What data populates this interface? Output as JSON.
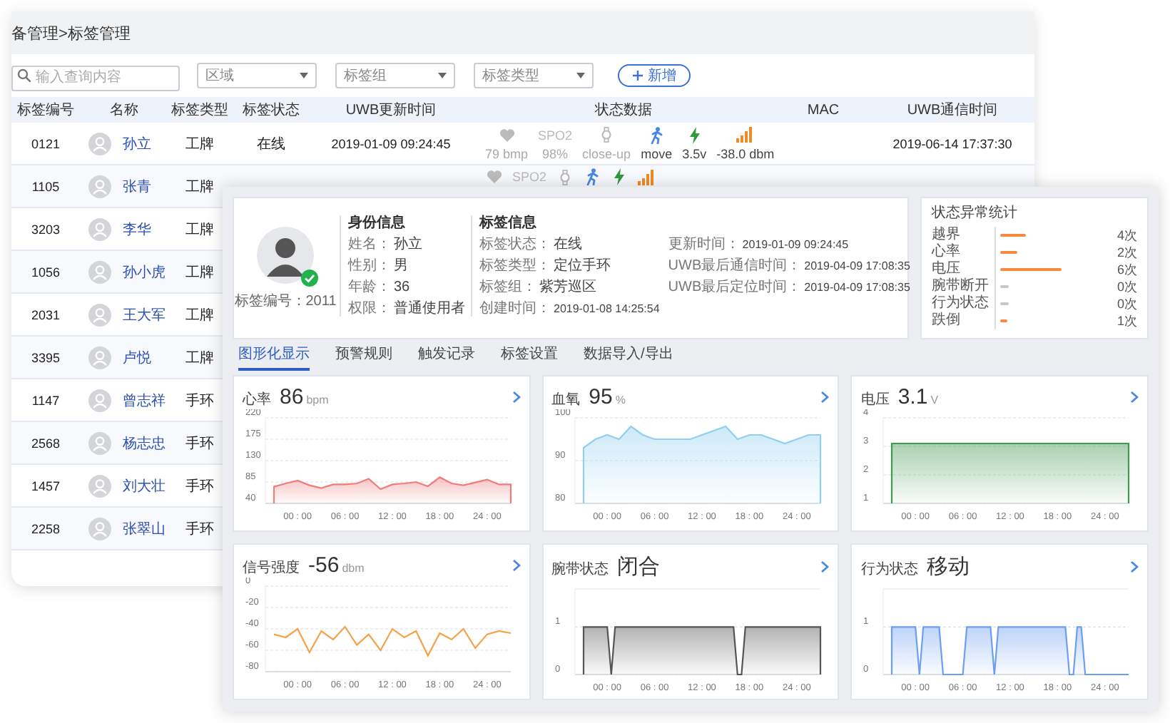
{
  "list_window": {
    "breadcrumb": "备管理>标签管理",
    "search": {
      "placeholder": "输入查询内容"
    },
    "filters": [
      {
        "placeholder": "区域"
      },
      {
        "placeholder": "标签组"
      },
      {
        "placeholder": "标签类型"
      }
    ],
    "add_button": "新增",
    "table": {
      "columns": [
        "标签编号",
        "名称",
        "标签类型",
        "标签状态",
        "UWB更新时间",
        "状态数据",
        "MAC",
        "UWB通信时间"
      ],
      "rows": [
        {
          "id": "0121",
          "name": "孙立",
          "type": "工牌",
          "status": "在线",
          "uwb_update_time": "2019-01-09 09:24:45",
          "status_data": [
            {
              "kind": "heart",
              "active": false,
              "reading": "79 bmp"
            },
            {
              "kind": "spo2",
              "active": false,
              "label": "SPO2",
              "reading": "98%"
            },
            {
              "kind": "wristband",
              "active": false,
              "reading": "close-up"
            },
            {
              "kind": "motion",
              "active": true,
              "reading": "move"
            },
            {
              "kind": "battery",
              "active": true,
              "reading": "3.5v"
            },
            {
              "kind": "signal",
              "active": true,
              "reading": "-38.0 dbm"
            }
          ],
          "uwb_comm_time": "2019-06-14 17:37:30"
        },
        {
          "id": "1105",
          "name": "张青",
          "type": "工牌",
          "status_data": [
            {
              "kind": "heart",
              "active": false
            },
            {
              "kind": "spo2",
              "active": false,
              "label": "SPO2"
            },
            {
              "kind": "wristband",
              "active": false
            },
            {
              "kind": "motion",
              "active": true
            },
            {
              "kind": "battery",
              "active": true
            },
            {
              "kind": "signal",
              "active": true
            }
          ]
        },
        {
          "id": "3203",
          "name": "李华",
          "type": "工牌"
        },
        {
          "id": "1056",
          "name": "孙小虎",
          "type": "工牌"
        },
        {
          "id": "2031",
          "name": "王大军",
          "type": "工牌"
        },
        {
          "id": "3395",
          "name": "卢悦",
          "type": "工牌"
        },
        {
          "id": "1147",
          "name": "曾志祥",
          "type": "手环"
        },
        {
          "id": "2568",
          "name": "杨志忠",
          "type": "手环"
        },
        {
          "id": "1457",
          "name": "刘大壮",
          "type": "手环"
        },
        {
          "id": "2258",
          "name": "张翠山",
          "type": "手环"
        }
      ]
    }
  },
  "detail_panel": {
    "profile": {
      "tag_number": "标签编号：2011",
      "identity": {
        "heading": "身份信息",
        "fields": [
          {
            "label": "姓名：",
            "value": "孙立"
          },
          {
            "label": "性别：",
            "value": "男"
          },
          {
            "label": "年龄：",
            "value": "36"
          },
          {
            "label": "权限：",
            "value": "普通使用者"
          }
        ]
      },
      "tag_info": {
        "heading": "标签信息",
        "fields": [
          {
            "label": "标签状态：",
            "value": "在线"
          },
          {
            "label": "标签类型：",
            "value": "定位手环"
          },
          {
            "label": "标签组：",
            "value": "紫芳巡区"
          },
          {
            "label": "创建时间：",
            "value": "2019-01-08 14:25:54"
          }
        ],
        "times": [
          {
            "label": "更新时间：",
            "value": "2019-01-09 09:24:45"
          },
          {
            "label": "UWB最后通信时间：",
            "value": "2019-04-09 17:08:35"
          },
          {
            "label": "UWB最后定位时间：",
            "value": "2019-04-09 17:08:35"
          }
        ]
      }
    },
    "stats": {
      "title": "状态异常统计",
      "rows": [
        {
          "label": "越界",
          "level": 0.24,
          "count": "4次"
        },
        {
          "label": "心率",
          "level": 0.155,
          "count": "2次"
        },
        {
          "label": "电压",
          "level": 0.56,
          "count": "6次"
        },
        {
          "label": "腕带断开",
          "level": 0,
          "count": "0次"
        },
        {
          "label": "行为状态",
          "level": 0,
          "count": "0次"
        },
        {
          "label": "跌倒",
          "level": 0.07,
          "count": "1次"
        }
      ]
    },
    "tabs": [
      {
        "label": "图形化显示",
        "selected": true
      },
      {
        "label": "预警规则",
        "selected": false
      },
      {
        "label": "触发记录",
        "selected": false
      },
      {
        "label": "标签设置",
        "selected": false
      },
      {
        "label": "数据导入/导出",
        "selected": false
      }
    ],
    "charts": [
      {
        "label": "心率",
        "value": "86",
        "unit": "bpm",
        "chart_data": {
          "type": "area",
          "categories": [
            null,
            null,
            "00 : 00",
            null,
            null,
            null,
            "06 : 00",
            null,
            null,
            null,
            "12 : 00",
            null,
            null,
            null,
            "18 : 00",
            null,
            null,
            null,
            "24 : 00",
            null,
            null
          ],
          "series": [
            {
              "color": "#ef7b7b",
              "values": [
                75,
                82,
                88,
                78,
                72,
                80,
                80,
                82,
                92,
                70,
                80,
                82,
                85,
                76,
                95,
                82,
                78,
                84,
                90,
                80,
                80
              ]
            }
          ],
          "grid": true,
          "ylim": [
            40,
            220
          ],
          "yticks": [
            40,
            85,
            130,
            175,
            220
          ]
        }
      },
      {
        "label": "血氧",
        "value": "95",
        "unit": "%",
        "chart_data": {
          "type": "area",
          "categories": [
            null,
            null,
            "00 : 00",
            null,
            null,
            null,
            "06 : 00",
            null,
            null,
            null,
            "12 : 00",
            null,
            null,
            null,
            "18 : 00",
            null,
            null,
            null,
            "24 : 00",
            null,
            null
          ],
          "series": [
            {
              "color": "#8fcff0",
              "values": [
                93,
                95,
                96,
                95,
                98,
                96,
                95,
                95,
                95,
                95,
                96,
                97,
                98,
                95,
                96,
                96,
                95,
                94,
                95,
                96,
                96
              ]
            }
          ],
          "grid": true,
          "ylim": [
            80,
            100
          ],
          "yticks": [
            80,
            90,
            100
          ]
        }
      },
      {
        "label": "电压",
        "value": "3.1",
        "unit": "V",
        "chart_data": {
          "type": "area",
          "categories": [
            null,
            null,
            "00 : 00",
            null,
            null,
            null,
            "06 : 00",
            null,
            null,
            null,
            "12 : 00",
            null,
            null,
            null,
            "18 : 00",
            null,
            null,
            null,
            "24 : 00",
            null,
            null
          ],
          "series": [
            {
              "color": "#3f9a4f",
              "values": [
                3.1,
                3.1,
                3.1,
                3.1,
                3.1,
                3.1,
                3.1,
                3.1,
                3.1,
                3.1,
                3.1,
                3.1,
                3.1,
                3.1,
                3.1,
                3.1,
                3.1,
                3.1,
                3.1,
                3.1,
                3.1
              ]
            }
          ],
          "grid": true,
          "ylim": [
            1,
            4
          ],
          "yticks": [
            1,
            2,
            3,
            4
          ]
        }
      },
      {
        "label": "信号强度",
        "value": "-56",
        "unit": "dbm",
        "chart_data": {
          "type": "line",
          "categories": [
            null,
            null,
            "00 : 00",
            null,
            null,
            null,
            "06 : 00",
            null,
            null,
            null,
            "12 : 00",
            null,
            null,
            null,
            "18 : 00",
            null,
            null,
            null,
            "24 : 00",
            null,
            null
          ],
          "series": [
            {
              "color": "#f5a14a",
              "values": [
                -45,
                -48,
                -40,
                -62,
                -42,
                -50,
                -38,
                -55,
                -45,
                -60,
                -40,
                -48,
                -42,
                -65,
                -44,
                -50,
                -40,
                -58,
                -45,
                -42,
                -44
              ]
            }
          ],
          "grid": true,
          "ylim": [
            -80,
            0
          ],
          "yticks": [
            -80,
            -60,
            -40,
            -20,
            0
          ]
        }
      },
      {
        "label": "腕带状态",
        "value": "闭合",
        "chart_data": {
          "type": "area",
          "categories": [
            null,
            null,
            null,
            null,
            null,
            null,
            "00 : 00",
            null,
            null,
            null,
            null,
            null,
            null,
            null,
            null,
            null,
            null,
            null,
            "06 : 00",
            null,
            null,
            null,
            null,
            null,
            null,
            null,
            null,
            null,
            null,
            null,
            "12 : 00",
            null,
            null,
            null,
            null,
            null,
            null,
            null,
            null,
            null,
            null,
            null,
            "18 : 00",
            null,
            null,
            null,
            null,
            null,
            null,
            null,
            null,
            null,
            null,
            null,
            "24 : 00",
            null,
            null,
            null,
            null,
            null,
            null
          ],
          "series": [
            {
              "color": "#555555",
              "values": [
                1,
                1,
                1,
                1,
                1,
                1,
                1,
                0,
                1,
                1,
                1,
                1,
                1,
                1,
                1,
                1,
                1,
                1,
                1,
                1,
                1,
                1,
                1,
                1,
                1,
                1,
                1,
                1,
                1,
                1,
                1,
                1,
                1,
                1,
                1,
                1,
                1,
                1,
                1,
                0,
                0,
                1,
                1,
                1,
                1,
                1,
                1,
                1,
                1,
                1,
                1,
                1,
                1,
                1,
                1,
                1,
                1,
                1,
                1,
                1,
                1
              ]
            }
          ],
          "grid": true,
          "ylim": [
            0,
            1.8
          ],
          "yticks": [
            0,
            1
          ]
        }
      },
      {
        "label": "行为状态",
        "value": "移动",
        "chart_data": {
          "type": "area",
          "categories": [
            null,
            null,
            null,
            null,
            null,
            null,
            "00 : 00",
            null,
            null,
            null,
            null,
            null,
            null,
            null,
            null,
            null,
            null,
            null,
            "06 : 00",
            null,
            null,
            null,
            null,
            null,
            null,
            null,
            null,
            null,
            null,
            null,
            "12 : 00",
            null,
            null,
            null,
            null,
            null,
            null,
            null,
            null,
            null,
            null,
            null,
            "18 : 00",
            null,
            null,
            null,
            null,
            null,
            null,
            null,
            null,
            null,
            null,
            null,
            "24 : 00",
            null,
            null,
            null,
            null,
            null,
            null
          ],
          "series": [
            {
              "color": "#6c9ef2",
              "values": [
                1,
                1,
                1,
                1,
                1,
                1,
                1,
                0,
                1,
                1,
                1,
                1,
                1,
                0,
                0,
                0,
                0,
                0,
                0,
                1,
                1,
                1,
                1,
                1,
                1,
                1,
                0,
                1,
                1,
                1,
                1,
                1,
                1,
                1,
                1,
                1,
                1,
                1,
                1,
                1,
                1,
                1,
                1,
                1,
                1,
                0,
                0,
                1,
                1,
                0,
                0,
                0,
                0,
                0,
                0,
                0,
                0,
                0,
                0,
                0,
                0
              ]
            }
          ],
          "grid": true,
          "ylim": [
            0,
            1.8
          ],
          "yticks": [
            0,
            1
          ]
        }
      }
    ]
  }
}
